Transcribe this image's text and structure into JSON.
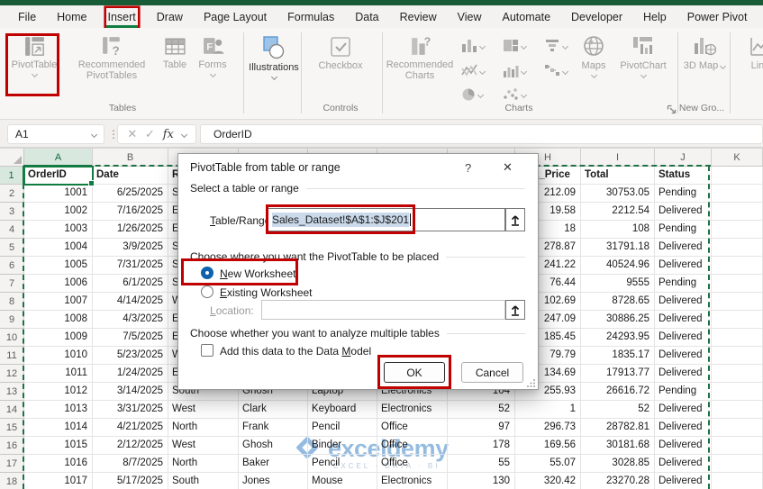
{
  "colors": {
    "excel_green": "#107C41",
    "title_strip_green": "#185C37",
    "annotation_red": "#C00000",
    "radio_blue": "#0F62AD",
    "watermark_blue": "#2E7CC3"
  },
  "selected_tab": "Insert",
  "menu_tabs": [
    "File",
    "Home",
    "Insert",
    "Draw",
    "Page Layout",
    "Formulas",
    "Data",
    "Review",
    "View",
    "Automate",
    "Developer",
    "Help",
    "Power Pivot"
  ],
  "ribbon": {
    "groups": {
      "tables": "Tables",
      "controls": "Controls",
      "charts": "Charts",
      "new_group": "New Gro..."
    },
    "buttons": {
      "pivottable": "PivotTable",
      "recommended_pivottables": "Recommended PivotTables",
      "table": "Table",
      "forms": "Forms",
      "illustrations": "Illustrations",
      "checkbox": "Checkbox",
      "recommended_charts": "Recommended Charts",
      "maps": "Maps",
      "pivotchart": "PivotChart",
      "map_3d": "3D Map",
      "line": "Line"
    }
  },
  "formula_bar": {
    "name_box": "A1",
    "formula": "OrderID"
  },
  "dialog": {
    "title": "PivotTable from table or range",
    "help_glyph": "?",
    "close_glyph": "✕",
    "section_range": "Select a table or range",
    "section_place": "Choose where you want the PivotTable to be placed",
    "section_analyze": "Choose whether you want to analyze multiple tables",
    "labels": {
      "table_range": {
        "pre": "",
        "key": "T",
        "post": "able/Range:"
      },
      "new_worksheet": {
        "pre": "",
        "key": "N",
        "post": "ew Worksheet"
      },
      "existing_worksheet": {
        "pre": "",
        "key": "E",
        "post": "xisting Worksheet"
      },
      "location": {
        "pre": "",
        "key": "L",
        "post": "ocation:"
      },
      "data_model": {
        "pre": "Add this data to the Data ",
        "key": "M",
        "post": "odel"
      }
    },
    "table_range_value": "Sales_Dataset!$A$1:$J$201",
    "location_value": "",
    "ok_label": "OK",
    "cancel_label": "Cancel"
  },
  "sheet": {
    "col_letters": [
      "A",
      "B",
      "C",
      "D",
      "E",
      "F",
      "G",
      "H",
      "I",
      "J",
      "K"
    ],
    "row_count": 18,
    "rows": [
      [
        "OrderID",
        "Date",
        "Region",
        "",
        "",
        "",
        "",
        "Unit_Price",
        "Total",
        "Status"
      ],
      [
        "1001",
        "6/25/2025",
        "S",
        "",
        "",
        "",
        "",
        "212.09",
        "30753.05",
        "Pending"
      ],
      [
        "1002",
        "7/16/2025",
        "E",
        "",
        "",
        "",
        "",
        "19.58",
        "2212.54",
        "Delivered"
      ],
      [
        "1003",
        "1/26/2025",
        "E",
        "",
        "",
        "",
        "",
        "18",
        "108",
        "Pending"
      ],
      [
        "1004",
        "3/9/2025",
        "S",
        "",
        "",
        "",
        "",
        "278.87",
        "31791.18",
        "Delivered"
      ],
      [
        "1005",
        "7/31/2025",
        "S",
        "",
        "",
        "",
        "",
        "241.22",
        "40524.96",
        "Delivered"
      ],
      [
        "1006",
        "6/1/2025",
        "S",
        "",
        "",
        "",
        "",
        "76.44",
        "9555",
        "Pending"
      ],
      [
        "1007",
        "4/14/2025",
        "W",
        "",
        "",
        "",
        "",
        "102.69",
        "8728.65",
        "Delivered"
      ],
      [
        "1008",
        "4/3/2025",
        "E",
        "",
        "",
        "",
        "",
        "247.09",
        "30886.25",
        "Delivered"
      ],
      [
        "1009",
        "7/5/2025",
        "E",
        "",
        "",
        "",
        "",
        "185.45",
        "24293.95",
        "Delivered"
      ],
      [
        "1010",
        "5/23/2025",
        "W",
        "",
        "",
        "",
        "",
        "79.79",
        "1835.17",
        "Delivered"
      ],
      [
        "1011",
        "1/24/2025",
        "E",
        "",
        "",
        "",
        "",
        "134.69",
        "17913.77",
        "Delivered"
      ],
      [
        "1012",
        "3/14/2025",
        "South",
        "Ghosh",
        "Laptop",
        "Electronics",
        "104",
        "255.93",
        "26616.72",
        "Pending"
      ],
      [
        "1013",
        "3/31/2025",
        "West",
        "Clark",
        "Keyboard",
        "Electronics",
        "52",
        "1",
        "52",
        "Delivered"
      ],
      [
        "1014",
        "4/21/2025",
        "North",
        "Frank",
        "Pencil",
        "Office",
        "97",
        "296.73",
        "28782.81",
        "Delivered"
      ],
      [
        "1015",
        "2/12/2025",
        "West",
        "Ghosh",
        "Binder",
        "Office",
        "178",
        "169.56",
        "30181.68",
        "Delivered"
      ],
      [
        "1016",
        "8/7/2025",
        "North",
        "Baker",
        "Pencil",
        "Office",
        "55",
        "55.07",
        "3028.85",
        "Delivered"
      ],
      [
        "1017",
        "5/17/2025",
        "South",
        "Jones",
        "Mouse",
        "Electronics",
        "130",
        "320.42",
        "23270.28",
        "Delivered"
      ]
    ]
  },
  "watermark": {
    "brand": "exceldemy",
    "tagline": "EXCEL · DATA · BI"
  }
}
